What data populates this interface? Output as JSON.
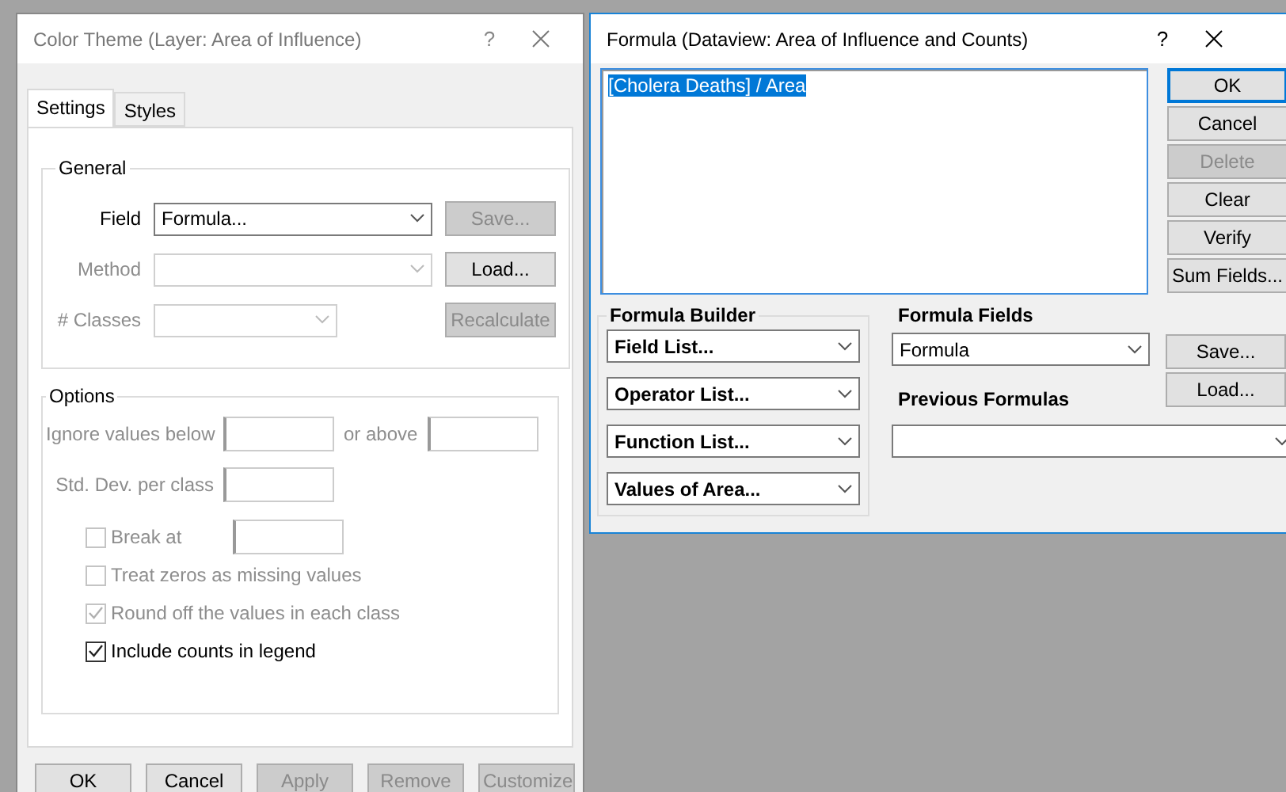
{
  "color_theme_dialog": {
    "title": "Color Theme (Layer: Area of Influence)",
    "help": "?",
    "tabs": [
      {
        "label": "Settings",
        "selected": true
      },
      {
        "label": "Styles",
        "selected": false
      }
    ],
    "general": {
      "legend": "General",
      "rows": [
        {
          "label": "Field",
          "value": "Formula...",
          "disabled": false,
          "wide": true,
          "button": {
            "label": "Save...",
            "disabled": true
          }
        },
        {
          "label": "Method",
          "value": "",
          "disabled": true,
          "wide": true,
          "button": {
            "label": "Load...",
            "disabled": false
          }
        },
        {
          "label": "# Classes",
          "value": "",
          "disabled": true,
          "wide": false,
          "button": {
            "label": "Recalculate",
            "disabled": true
          }
        }
      ]
    },
    "options": {
      "legend": "Options",
      "ignore_below_label": "Ignore values below",
      "or_above_label": "or above",
      "std_dev_label": "Std. Dev. per class",
      "disabled": true,
      "checks": [
        {
          "label": "Break at",
          "checked": false,
          "disabled": true,
          "has_input": true
        },
        {
          "label": "Treat zeros as missing values",
          "checked": false,
          "disabled": true,
          "has_input": false
        },
        {
          "label": "Round off the values in each class",
          "checked": true,
          "disabled": true,
          "has_input": false
        },
        {
          "label": "Include counts in legend",
          "checked": true,
          "disabled": false,
          "has_input": false
        }
      ]
    },
    "buttons": [
      {
        "label": "OK",
        "disabled": false
      },
      {
        "label": "Cancel",
        "disabled": false
      },
      {
        "label": "Apply",
        "disabled": true
      },
      {
        "label": "Remove",
        "disabled": true
      },
      {
        "label": "Customize",
        "disabled": true
      }
    ]
  },
  "formula_dialog": {
    "title": "Formula (Dataview: Area of Influence and Counts)",
    "help": "?",
    "formula": {
      "text": "[Cholera Deaths] / Area",
      "selected": true
    },
    "side_buttons": [
      {
        "label": "OK",
        "disabled": false,
        "default": true
      },
      {
        "label": "Cancel",
        "disabled": false,
        "default": false
      },
      {
        "label": "Delete",
        "disabled": true,
        "default": false
      },
      {
        "label": "Clear",
        "disabled": false,
        "default": false
      },
      {
        "label": "Verify",
        "disabled": false,
        "default": false
      },
      {
        "label": "Sum Fields...",
        "disabled": false,
        "default": false
      }
    ],
    "builder": {
      "legend": "Formula Builder",
      "lists": [
        "Field List...",
        "Operator List...",
        "Function List...",
        "Values of Area..."
      ]
    },
    "formula_fields": {
      "label": "Formula Fields",
      "value": "Formula"
    },
    "field_buttons": [
      {
        "label": "Save...",
        "disabled": false
      },
      {
        "label": "Load...",
        "disabled": false
      }
    ],
    "previous": {
      "label": "Previous Formulas"
    }
  }
}
